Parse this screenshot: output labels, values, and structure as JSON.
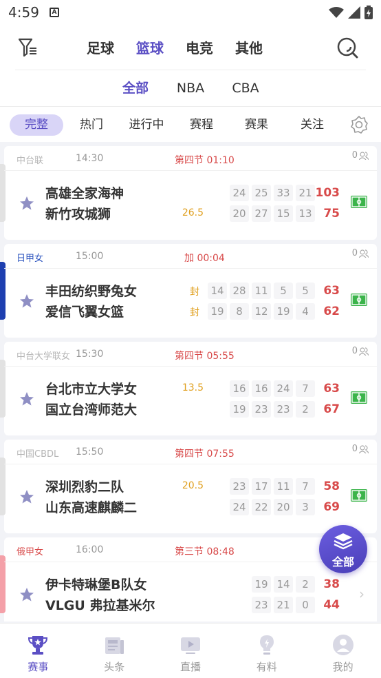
{
  "status_bar": {
    "time": "4:59",
    "notif_icon": "A"
  },
  "header": {
    "sport_tabs": [
      "足球",
      "篮球",
      "电竞",
      "其他"
    ],
    "active_tab": 1
  },
  "leagues": {
    "items": [
      "全部",
      "NBA",
      "CBA"
    ],
    "active": 0
  },
  "filters": {
    "items": [
      "完整",
      "热门",
      "进行中",
      "赛程",
      "赛果",
      "关注"
    ],
    "active": 0
  },
  "matches": [
    {
      "league": "中台联",
      "time": "14:30",
      "status": "第四节 01:10",
      "fans": "0",
      "home": "高雄全家海神",
      "away": "新竹攻城狮",
      "home_q": [
        "24",
        "25",
        "33",
        "21"
      ],
      "away_q": [
        "20",
        "27",
        "15",
        "13"
      ],
      "home_h": "",
      "away_h": "26.5",
      "home_total": "103",
      "away_total": "75"
    },
    {
      "league": "日甲女",
      "time": "15:00",
      "status": "加 00:04",
      "fans": "0",
      "home": "丰田纺织野兔女",
      "away": "爱信飞翼女篮",
      "home_q": [
        "14",
        "28",
        "11",
        "5",
        "5"
      ],
      "away_q": [
        "19",
        "8",
        "12",
        "19",
        "4"
      ],
      "home_h": "封",
      "away_h": "封",
      "home_total": "63",
      "away_total": "62"
    },
    {
      "league": "中台大学联女",
      "time": "15:30",
      "status": "第四节 05:55",
      "fans": "0",
      "home": "台北市立大学女",
      "away": "国立台湾师范大",
      "home_q": [
        "16",
        "16",
        "24",
        "7"
      ],
      "away_q": [
        "19",
        "23",
        "23",
        "2"
      ],
      "home_h": "13.5",
      "away_h": "",
      "home_total": "63",
      "away_total": "67"
    },
    {
      "league": "中国CBDL",
      "time": "15:50",
      "status": "第四节 07:55",
      "fans": "0",
      "home": "深圳烈豹二队",
      "away": "山东高速麒麟二",
      "home_q": [
        "23",
        "17",
        "11",
        "7"
      ],
      "away_q": [
        "24",
        "22",
        "20",
        "3"
      ],
      "home_h": "20.5",
      "away_h": "",
      "home_total": "58",
      "away_total": "69"
    },
    {
      "league": "俄甲女",
      "time": "16:00",
      "status": "第三节 08:48",
      "fans": "",
      "home": "伊卡特琳堡B队女",
      "away": "VLGU 弗拉基米尔",
      "home_q": [
        "19",
        "14",
        "2"
      ],
      "away_q": [
        "23",
        "21",
        "0"
      ],
      "home_h": "",
      "away_h": "",
      "home_total": "38",
      "away_total": "44"
    }
  ],
  "fab": {
    "label": "全部"
  },
  "bottom_nav": {
    "items": [
      "赛事",
      "头条",
      "直播",
      "有料",
      "我的"
    ],
    "active": 0
  },
  "colors": {
    "accent": "#5b4fc4",
    "score_red": "#d84a4a",
    "handicap": "#e0a020",
    "live_green": "#3cb44b"
  }
}
